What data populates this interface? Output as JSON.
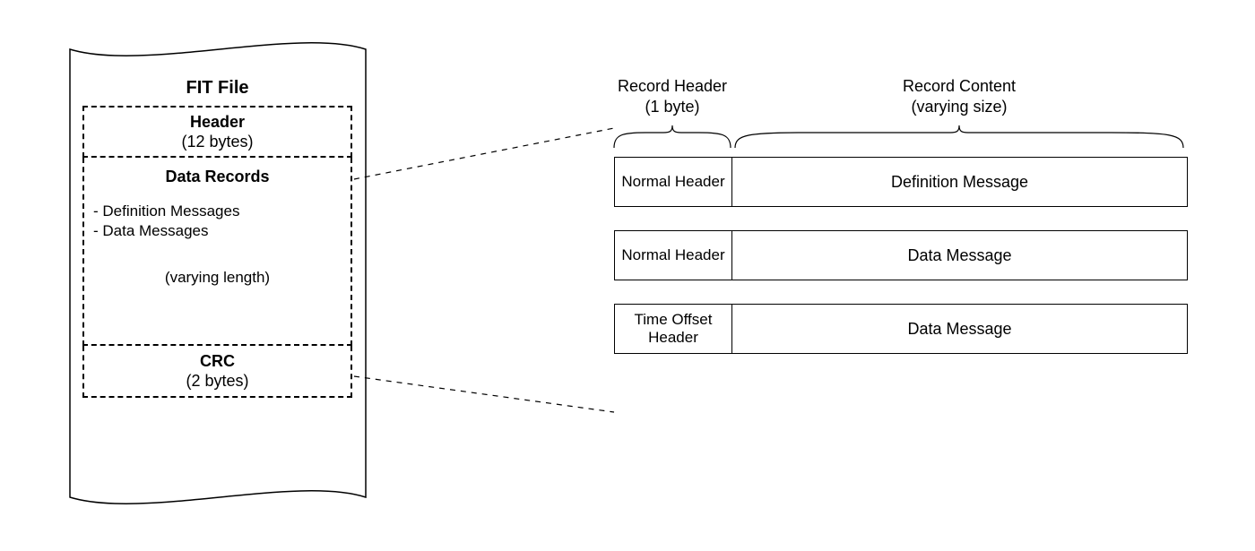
{
  "fit_file": {
    "title": "FIT File",
    "header": {
      "title": "Header",
      "size": "(12 bytes)"
    },
    "data_records": {
      "title": "Data Records",
      "items": [
        "- Definition Messages",
        "- Data Messages"
      ],
      "note": "(varying length)"
    },
    "crc": {
      "title": "CRC",
      "size": "(2 bytes)"
    }
  },
  "brace_labels": {
    "record_header": {
      "title": "Record Header",
      "sub": "(1 byte)"
    },
    "record_content": {
      "title": "Record Content",
      "sub": "(varying size)"
    }
  },
  "records": [
    {
      "header": "Normal Header",
      "content": "Definition Message"
    },
    {
      "header": "Normal Header",
      "content": "Data Message"
    },
    {
      "header": "Time Offset Header",
      "content": "Data Message"
    }
  ]
}
